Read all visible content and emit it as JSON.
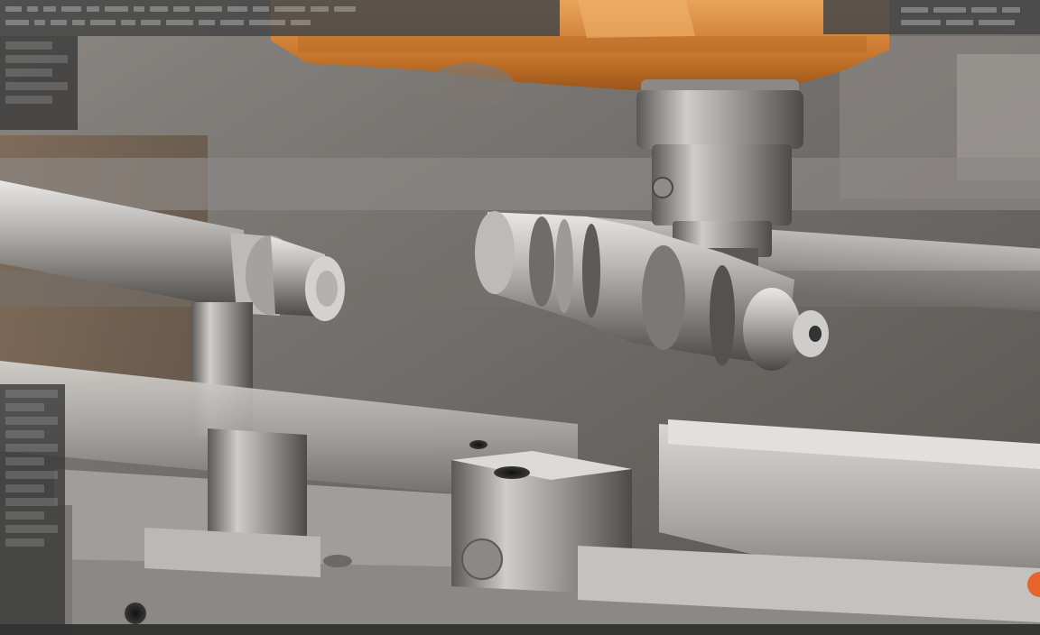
{
  "scene": {
    "subject": "",
    "overlay_text": []
  },
  "colors": {
    "background": "#6e6c69",
    "steel_light": "#cfcfcd",
    "steel_mid": "#9a9896",
    "steel_dark": "#4d4b49",
    "housing_orange": "#d27d2c",
    "ui_panel": "#3a3a3a",
    "accent_orange": "#e8642a"
  },
  "icons": {
    "status_dot": "orange-dot-icon"
  }
}
